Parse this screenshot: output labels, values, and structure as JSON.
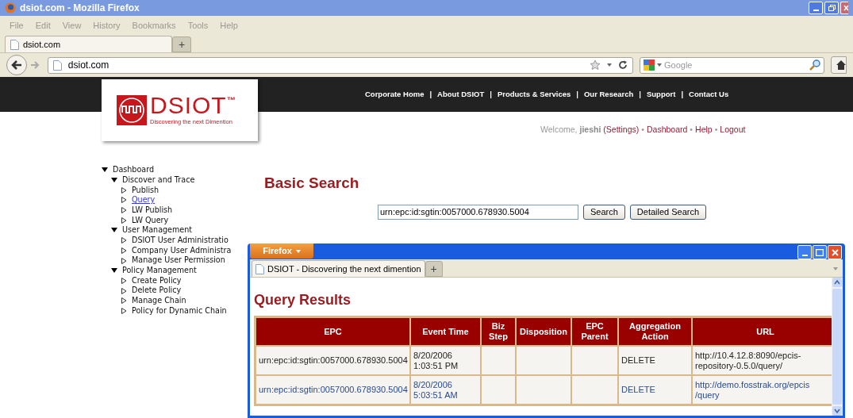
{
  "window": {
    "title": "dsiot.com - Mozilla Firefox"
  },
  "menu": [
    "File",
    "Edit",
    "View",
    "History",
    "Bookmarks",
    "Tools",
    "Help"
  ],
  "tabs": [
    {
      "label": "dsiot.com",
      "selected": true
    }
  ],
  "new_tab": "+",
  "address": {
    "value": "dsiot.com"
  },
  "search": {
    "placeholder": "Google"
  },
  "site_nav": {
    "separator": "|",
    "links": [
      "Corporate Home",
      "About DSIOT",
      "Products & Services",
      "Our Research",
      "Support",
      "Contact Us"
    ]
  },
  "logo": {
    "name": "DSIOT",
    "trademark": "™",
    "tagline": "Discovering the next Dimention"
  },
  "welcome": {
    "greeting": "Welcome,",
    "user": "jieshi",
    "settings": "(Settings)",
    "separator": "•",
    "links": [
      "Dashboard",
      "Help",
      "Logout"
    ]
  },
  "tree": [
    {
      "label": "Dashboard",
      "expanded": true,
      "selected": false,
      "children": [
        {
          "label": "Discover and Trace",
          "expanded": true,
          "selected": false,
          "children": [
            {
              "label": "Publish",
              "expanded": false,
              "selected": false
            },
            {
              "label": "Query",
              "expanded": false,
              "selected": true
            },
            {
              "label": "LW Publish",
              "expanded": false,
              "selected": false
            },
            {
              "label": "LW Query",
              "expanded": false,
              "selected": false
            }
          ]
        },
        {
          "label": "User Management",
          "expanded": true,
          "selected": false,
          "children": [
            {
              "label": "DSIOT User Administratio",
              "expanded": false,
              "selected": false
            },
            {
              "label": "Company User Administra",
              "expanded": false,
              "selected": false
            },
            {
              "label": "Manage User Permission",
              "expanded": false,
              "selected": false
            }
          ]
        },
        {
          "label": "Policy Management",
          "expanded": true,
          "selected": false,
          "children": [
            {
              "label": "Create Policy",
              "expanded": false,
              "selected": false
            },
            {
              "label": "Delete Policy",
              "expanded": false,
              "selected": false
            },
            {
              "label": "Manage Chain",
              "expanded": false,
              "selected": false
            },
            {
              "label": "Policy for Dynamic Chain",
              "expanded": false,
              "selected": false
            }
          ]
        }
      ]
    }
  ],
  "basic_search": {
    "title": "Basic Search",
    "value": "urn:epc:id:sgtin:0057000.678930.5004",
    "buttons": [
      "Search",
      "Detailed Search"
    ]
  },
  "popup": {
    "menu_button": "Firefox",
    "tabs": [
      {
        "label": "DSIOT - Discovering the next dimention",
        "selected": true
      }
    ],
    "new_tab": "+",
    "title": "Query Results",
    "table": {
      "columns": [
        "EPC",
        "Event Time",
        "Biz Step",
        "Disposition",
        "EPC Parent",
        "Aggregation Action",
        "URL"
      ],
      "rows": [
        {
          "linked": false,
          "cells": [
            "urn:epc:id:sgtin:0057000.678930.5004",
            "8/20/2006 1:03:51 PM",
            "",
            "",
            "",
            "DELETE",
            "http://10.4.12.8:8090/epcis-repository-0.5.0/query/"
          ]
        },
        {
          "linked": true,
          "cells": [
            "urn:epc:id:sgtin:0057000.678930.5004",
            "8/20/2006 5:03:51 AM",
            "",
            "",
            "",
            "DELETE",
            "http://demo.fosstrak.org/epcis /query"
          ]
        }
      ]
    }
  }
}
